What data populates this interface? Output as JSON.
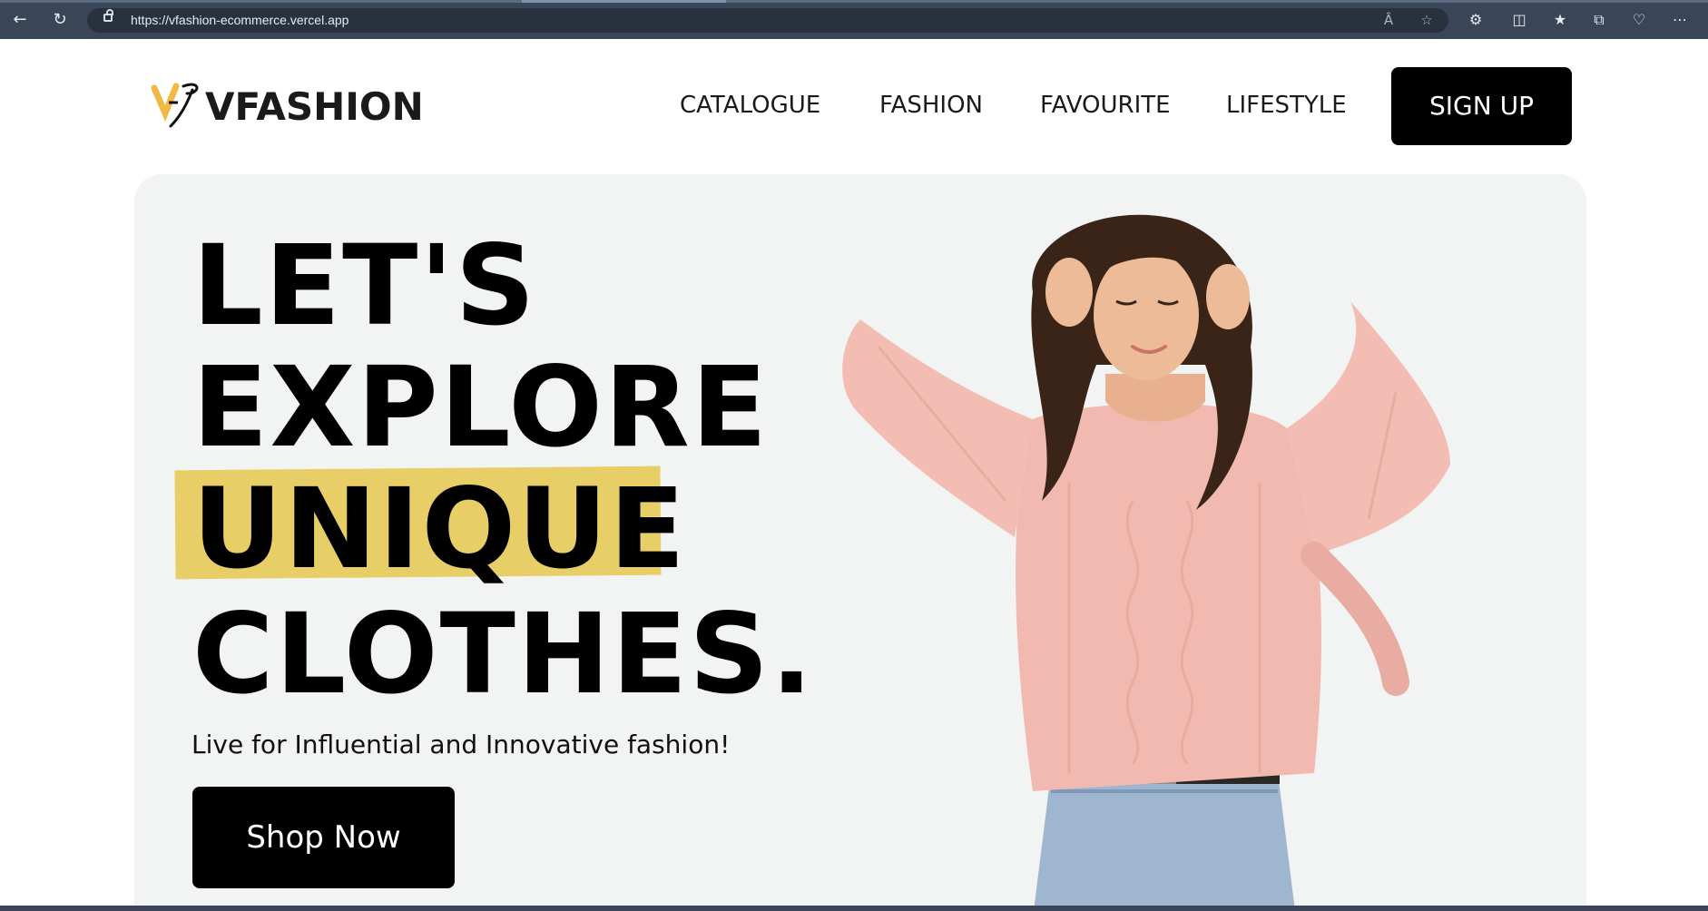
{
  "browser": {
    "url": "https://vfashion-ecommerce.vercel.app",
    "icons": [
      "back-icon",
      "refresh-icon",
      "lock-icon",
      "read-aloud-icon",
      "favorite-star-icon",
      "extensions-icon",
      "split-screen-icon",
      "favorites-icon",
      "collections-icon",
      "browser-essentials-icon",
      "more-icon"
    ]
  },
  "header": {
    "logo_text": "VFASHION",
    "nav": [
      {
        "label": "CATALOGUE"
      },
      {
        "label": "FASHION"
      },
      {
        "label": "FAVOURITE"
      },
      {
        "label": "LIFESTYLE"
      }
    ],
    "signup_label": "SIGN UP"
  },
  "hero": {
    "headline": [
      "LET'S",
      "EXPLORE",
      "UNIQUE",
      "CLOTHES."
    ],
    "tagline": "Live for Influential and Innovative fashion!",
    "cta_label": "Shop Now",
    "image_alt": "Woman in pink cable-knit sweater and jeans"
  },
  "colors": {
    "highlight": "#e7ce66",
    "hero_bg": "#f2f4f4",
    "button_bg": "#000000",
    "browser_chrome": "#3a4658",
    "logo_accent": "#f2b844"
  }
}
